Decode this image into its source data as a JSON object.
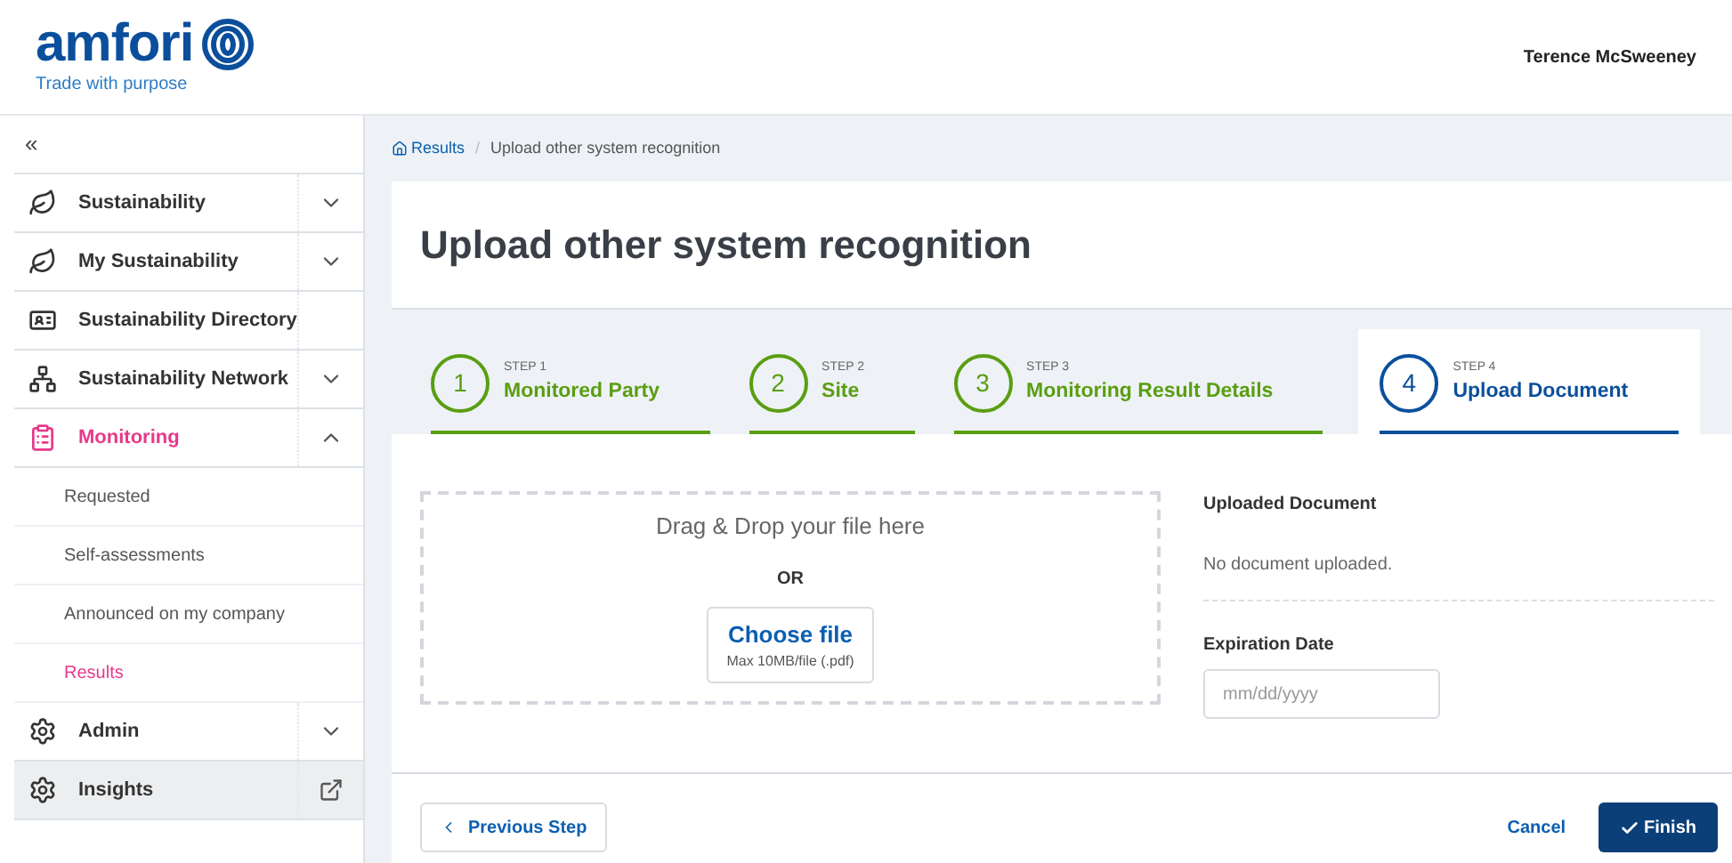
{
  "brand": {
    "name": "amfori",
    "tagline": "Trade with purpose"
  },
  "user": {
    "name": "Terence McSweeney"
  },
  "sidebar": {
    "collapse": "«",
    "items": [
      {
        "label": "Sustainability",
        "kind": "leaf",
        "expandable": true,
        "expanded": false,
        "selected": false
      },
      {
        "label": "My Sustainability",
        "kind": "leaf",
        "expandable": true,
        "expanded": false,
        "selected": false
      },
      {
        "label": "Sustainability Directory",
        "kind": "card",
        "selected": false
      },
      {
        "label": "Sustainability Network",
        "kind": "network",
        "expandable": true,
        "expanded": false,
        "selected": false
      },
      {
        "label": "Monitoring",
        "kind": "clipboard",
        "expandable": true,
        "expanded": true,
        "selected": true,
        "children": [
          {
            "label": "Requested",
            "selected": false
          },
          {
            "label": "Self-assessments",
            "selected": false
          },
          {
            "label": "Announced on my company",
            "selected": false
          },
          {
            "label": "Results",
            "selected": true
          }
        ]
      },
      {
        "label": "Admin",
        "kind": "gear",
        "expandable": true,
        "expanded": false,
        "selected": false
      },
      {
        "label": "Insights",
        "kind": "external",
        "selected": false
      }
    ]
  },
  "breadcrumb": [
    {
      "label": "Results",
      "kind": "link"
    },
    {
      "label": "Upload other system recognition",
      "kind": "current",
      "separator": "/"
    }
  ],
  "title": "Upload other system recognition",
  "steps": [
    {
      "number": "1",
      "caption": "STEP 1",
      "label": "Monitored Party",
      "selected": false
    },
    {
      "number": "2",
      "caption": "STEP 2",
      "label": "Site",
      "selected": false
    },
    {
      "number": "3",
      "caption": "STEP 3",
      "label": "Monitoring Result Details",
      "selected": false
    },
    {
      "number": "4",
      "caption": "STEP 4",
      "label": "Upload Document",
      "selected": true
    }
  ],
  "dropzone": {
    "prompt": "Drag & Drop your file here",
    "or": "OR",
    "button": "Choose file",
    "hint": "Max 10MB/file (.pdf)"
  },
  "uploaded": {
    "heading": "Uploaded Document",
    "text": "No document uploaded."
  },
  "expiration": {
    "label": "Expiration Date",
    "placeholder": "mm/dd/yyyy"
  },
  "footer": {
    "previous": "Previous Step",
    "cancel": "Cancel",
    "finish": "Finish"
  }
}
